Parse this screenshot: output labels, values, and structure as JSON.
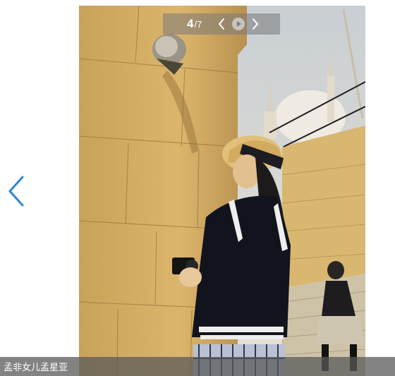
{
  "viewer": {
    "current": "4",
    "total": "/7",
    "caption": "孟非女儿孟星亚"
  },
  "icons": {
    "left_arrow": "chevron-left-icon",
    "ctrl_prev": "chevron-left-icon",
    "ctrl_play": "play-icon",
    "ctrl_next": "chevron-right-icon"
  },
  "colors": {
    "arrow_blue": "#2f86d8",
    "counter_bg": "#808080",
    "caption_bg": "#5a5a5a",
    "text_white": "#ffffff"
  }
}
